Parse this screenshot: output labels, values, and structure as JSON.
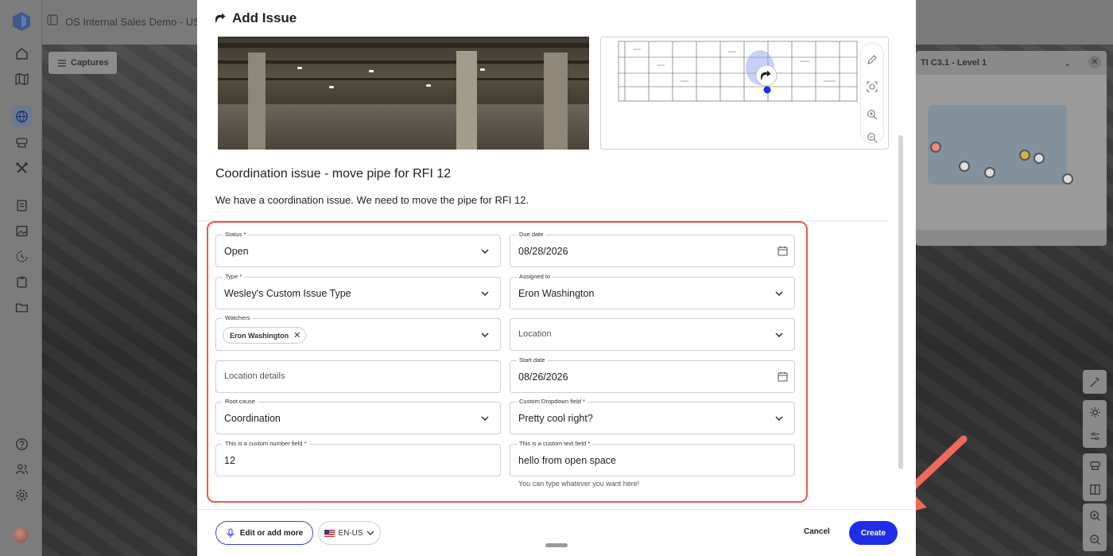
{
  "app": {
    "title": "OS Internal Sales Demo - US N"
  },
  "rail": {
    "icons": [
      "home-icon",
      "map-icon",
      "globe-icon",
      "capture-icon",
      "tools-icon",
      "document-icon",
      "image-icon",
      "schedule-icon",
      "clipboard-icon",
      "folder-icon",
      "help-icon",
      "users-icon",
      "settings-icon"
    ]
  },
  "viewer": {
    "captures_label": "Captures",
    "minimap_title": "TI C3.1 - Level 1"
  },
  "modal": {
    "title": "Add Issue",
    "issue_title": "Coordination issue - move pipe for RFI 12",
    "issue_description": "We have a coordination issue. We need to move the pipe for RFI 12.",
    "fields": {
      "status": {
        "label": "Status *",
        "value": "Open"
      },
      "due_date": {
        "label": "Due date",
        "value": "08/28/2026"
      },
      "type": {
        "label": "Type *",
        "value": "Wesley's Custom Issue Type"
      },
      "assigned_to": {
        "label": "Assigned to",
        "value": "Eron Washington"
      },
      "watchers": {
        "label": "Watchers",
        "chip": "Eron Washington"
      },
      "location": {
        "placeholder": "Location"
      },
      "location_details": {
        "placeholder": "Location details"
      },
      "start_date": {
        "label": "Start date",
        "value": "08/26/2026"
      },
      "root_cause": {
        "label": "Root cause",
        "value": "Coordination"
      },
      "custom_dropdown": {
        "label": "Custom Dropdown field *",
        "value": "Pretty cool right?"
      },
      "custom_number": {
        "label": "This is a custom number field *",
        "value": "12"
      },
      "custom_text": {
        "label": "This is a custom text field *",
        "value": "hello from open space",
        "helper": "You can type whatever you want here!"
      }
    },
    "footer": {
      "edit_label": "Edit or add more",
      "lang_label": "EN-US",
      "cancel_label": "Cancel",
      "create_label": "Create"
    }
  },
  "colors": {
    "accent": "#1f2ee6",
    "highlight_frame": "#e8584c",
    "annotation_arrow": "#ef6a5c"
  }
}
